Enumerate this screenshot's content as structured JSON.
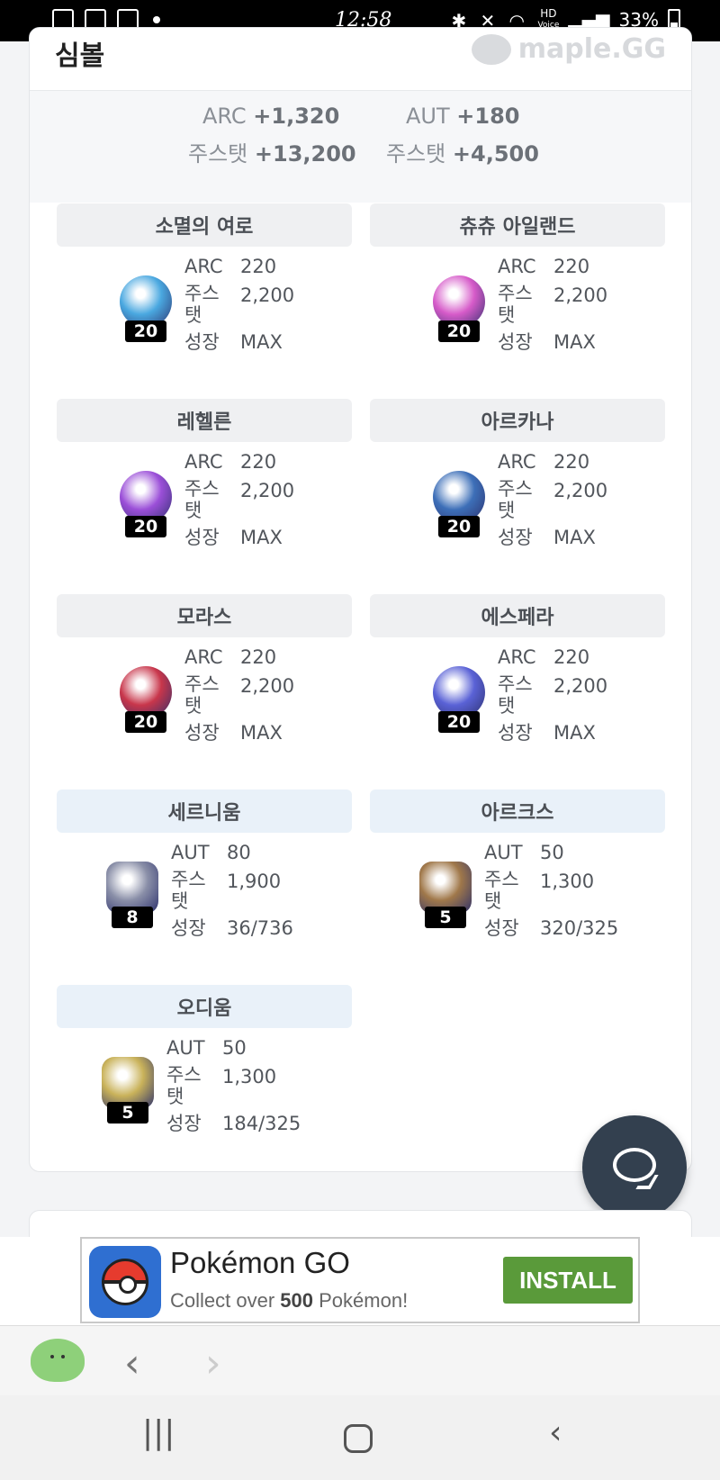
{
  "status_bar": {
    "time": "12:58",
    "battery": "33%",
    "hd_label": "HD",
    "voice_label": "Voice"
  },
  "card": {
    "title": "심볼",
    "brand": "maple.GG",
    "summary": {
      "arc_label": "ARC",
      "arc_value": "+1,320",
      "aut_label": "AUT",
      "aut_value": "+180",
      "arc_main_label": "주스탯",
      "arc_main_value": "+13,200",
      "aut_main_label": "주스탯",
      "aut_main_value": "+4,500"
    },
    "symbols": [
      {
        "name": "소멸의 여로",
        "level": "20",
        "stat1_label": "ARC",
        "stat1_value": "220",
        "stat2_label": "주스\n탯",
        "stat2_value": "2,200",
        "stat3_label": "성장",
        "stat3_value": "MAX",
        "color": "#4aa8e0"
      },
      {
        "name": "츄츄 아일랜드",
        "level": "20",
        "stat1_label": "ARC",
        "stat1_value": "220",
        "stat2_label": "주스\n탯",
        "stat2_value": "2,200",
        "stat3_label": "성장",
        "stat3_value": "MAX",
        "color": "#d65bc9"
      },
      {
        "name": "레헬른",
        "level": "20",
        "stat1_label": "ARC",
        "stat1_value": "220",
        "stat2_label": "주스\n탯",
        "stat2_value": "2,200",
        "stat3_label": "성장",
        "stat3_value": "MAX",
        "color": "#9b4fd8"
      },
      {
        "name": "아르카나",
        "level": "20",
        "stat1_label": "ARC",
        "stat1_value": "220",
        "stat2_label": "주스\n탯",
        "stat2_value": "2,200",
        "stat3_label": "성장",
        "stat3_value": "MAX",
        "color": "#3d6fb8"
      },
      {
        "name": "모라스",
        "level": "20",
        "stat1_label": "ARC",
        "stat1_value": "220",
        "stat2_label": "주스\n탯",
        "stat2_value": "2,200",
        "stat3_label": "성장",
        "stat3_value": "MAX",
        "color": "#c8364b"
      },
      {
        "name": "에스페라",
        "level": "20",
        "stat1_label": "ARC",
        "stat1_value": "220",
        "stat2_label": "주스\n탯",
        "stat2_value": "2,200",
        "stat3_label": "성장",
        "stat3_value": "MAX",
        "color": "#5a62d6"
      },
      {
        "name": "세르니움",
        "level": "8",
        "stat1_label": "AUT",
        "stat1_value": "80",
        "stat2_label": "주스\n탯",
        "stat2_value": "1,900",
        "stat3_label": "성장",
        "stat3_value": "36/736",
        "color": "#8a8fa8"
      },
      {
        "name": "아르크스",
        "level": "5",
        "stat1_label": "AUT",
        "stat1_value": "50",
        "stat2_label": "주스\n탯",
        "stat2_value": "1,300",
        "stat3_label": "성장",
        "stat3_value": "320/325",
        "color": "#a0784a"
      },
      {
        "name": "오디움",
        "level": "5",
        "stat1_label": "AUT",
        "stat1_value": "50",
        "stat2_label": "주스\n탯",
        "stat2_value": "1,300",
        "stat3_label": "성장",
        "stat3_value": "184/325",
        "color": "#c9b25a"
      }
    ]
  },
  "ad": {
    "title": "Pokémon GO",
    "sub_prefix": "Collect over",
    "sub_count": "500",
    "sub_suffix": "Pokémon!",
    "button": "INSTALL"
  },
  "browser_bar": {
    "back_glyph": "‹",
    "forward_glyph": "›"
  },
  "android_nav": {
    "recents_glyph": "|||",
    "back_glyph": "‹"
  }
}
